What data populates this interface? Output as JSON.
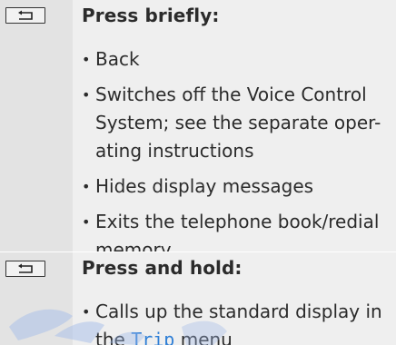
{
  "sections": [
    {
      "heading": "Press briefly:",
      "items": [
        "Back",
        "Switches off the Voice Control System; see the separate oper-ating instructions",
        "Hides display messages",
        "Exits the telephone book/redial memory"
      ]
    },
    {
      "heading": "Press and hold:",
      "item_prefix": "Calls up the standard display in the ",
      "item_menu": "Trip",
      "item_suffix": " menu"
    }
  ],
  "key_icon": "back-arrow-key-icon",
  "colors": {
    "left_column": "#e3e3e3",
    "right_column": "#efefef",
    "text": "#2b2b2b",
    "menu_highlight": "#2f7fd6"
  }
}
